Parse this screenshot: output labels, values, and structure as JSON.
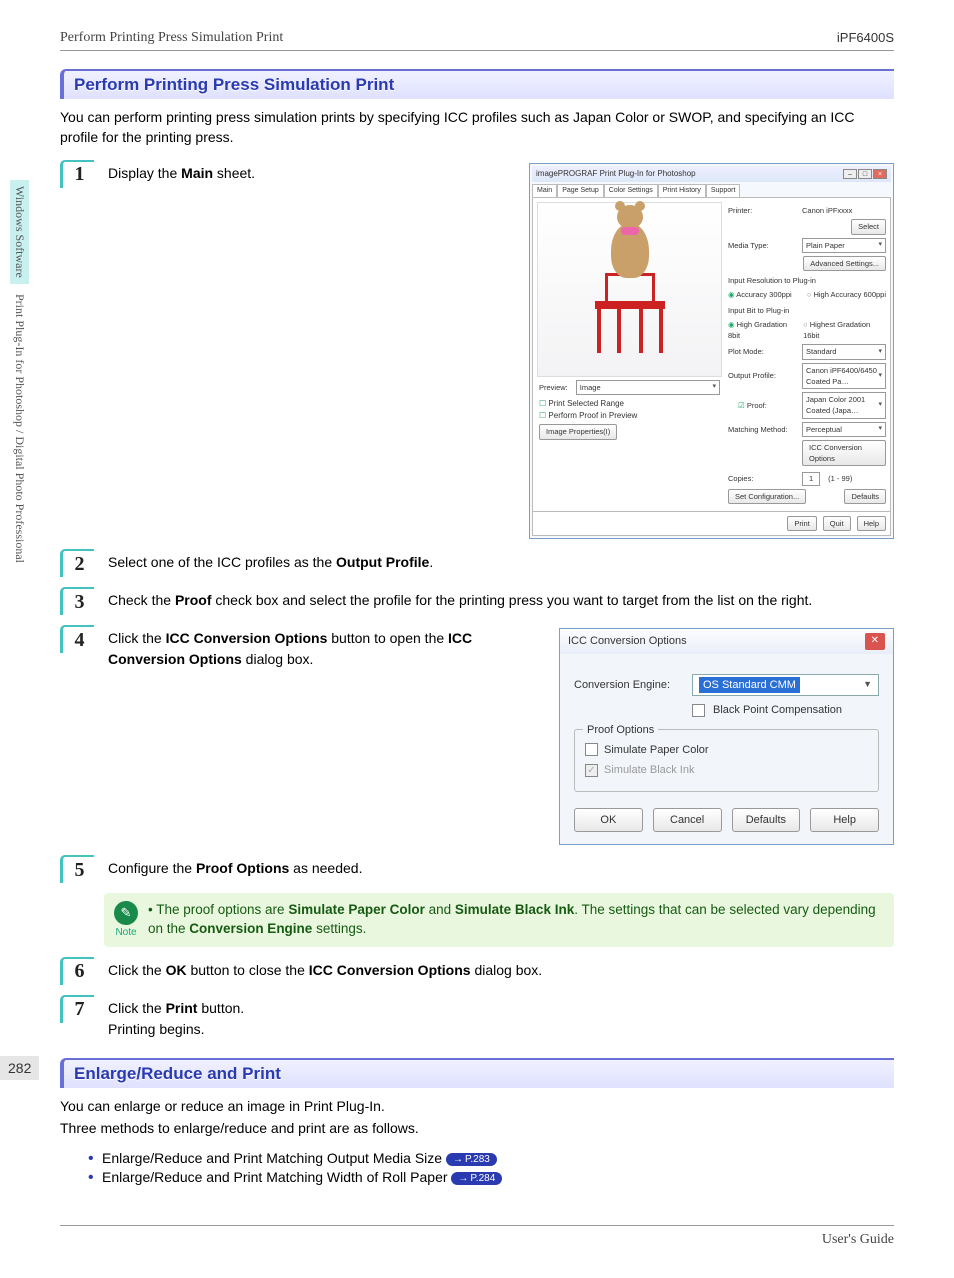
{
  "header": {
    "left": "Perform Printing Press Simulation Print",
    "right": "iPF6400S"
  },
  "side": {
    "tab1": "Windows Software",
    "tab2": "Print Plug-In for Photoshop / Digital Photo Professional"
  },
  "section1": {
    "title": "Perform Printing Press Simulation Print",
    "intro": "You can perform printing press simulation prints by specifying ICC profiles such as Japan Color or SWOP, and specifying an ICC profile for the printing press."
  },
  "steps": {
    "s1": {
      "num": "1",
      "pre": "Display the ",
      "b1": "Main",
      "post": " sheet."
    },
    "s2": {
      "num": "2",
      "pre": "Select one of the ICC profiles as the ",
      "b1": "Output Profile",
      "post": "."
    },
    "s3": {
      "num": "3",
      "pre": "Check the ",
      "b1": "Proof",
      "post": " check box and select the profile for the printing press you want to target from the list on the right."
    },
    "s4": {
      "num": "4",
      "pre": "Click the ",
      "b1": "ICC Conversion Options",
      "mid": " button to open the ",
      "b2": "ICC Conversion Options",
      "post": " dialog box."
    },
    "s5": {
      "num": "5",
      "pre": "Configure the ",
      "b1": "Proof Options",
      "post": " as needed."
    },
    "s6": {
      "num": "6",
      "pre": "Click the ",
      "b1": "OK",
      "mid": " button to close the ",
      "b2": "ICC Conversion Options",
      "post": " dialog box."
    },
    "s7": {
      "num": "7",
      "pre": "Click the ",
      "b1": "Print",
      "post": " button.",
      "line2": "Printing begins."
    }
  },
  "dialog1": {
    "title": "imagePROGRAF Print Plug-In for Photoshop",
    "tabs": [
      "Main",
      "Page Setup",
      "Color Settings",
      "Print History",
      "Support"
    ],
    "printer_l": "Printer:",
    "printer_v": "Canon iPFxxxx",
    "select_btn": "Select",
    "media_l": "Media Type:",
    "media_v": "Plain Paper",
    "adv_btn": "Advanced Settings...",
    "res_group": "Input Resolution to Plug-in",
    "res1": "Accuracy 300ppi",
    "res2": "High Accuracy 600ppi",
    "bit_group": "Input Bit to Plug-in",
    "bit1": "High Gradation 8bit",
    "bit2": "Highest Gradation 16bit",
    "plot_l": "Plot Mode:",
    "plot_v": "Standard",
    "out_l": "Output Profile:",
    "out_v": "Canon iPF6400/6450 Coated Pa…",
    "proof_l": "Proof:",
    "proof_v": "Japan Color 2001 Coated (Japa…",
    "match_l": "Matching Method:",
    "match_v": "Perceptual",
    "icc_btn": "ICC Conversion Options",
    "copies_l": "Copies:",
    "copies_v": "1",
    "copies_range": "(1 - 99)",
    "setconf": "Set Configuration...",
    "defaults": "Defaults",
    "print": "Print",
    "quit": "Quit",
    "help": "Help",
    "preview_l": "Preview:",
    "preview_v": "Image",
    "psr": "Print Selected Range",
    "ppp": "Perform Proof in Preview",
    "imgprop": "Image Properties(I)"
  },
  "dialog2": {
    "title": "ICC Conversion Options",
    "ce_l": "Conversion Engine:",
    "ce_v": "OS Standard CMM",
    "bpc": "Black Point Compensation",
    "group": "Proof Options",
    "spc": "Simulate Paper Color",
    "sbi": "Simulate Black Ink",
    "ok": "OK",
    "cancel": "Cancel",
    "defaults": "Defaults",
    "help": "Help"
  },
  "note": {
    "label": "Note",
    "pre": "The proof options are ",
    "b1": "Simulate Paper Color",
    "mid": " and ",
    "b2": "Simulate Black Ink",
    "post": ". The settings that can be selected vary depending on the ",
    "b3": "Conversion Engine",
    "end": " settings."
  },
  "section2": {
    "title": "Enlarge/Reduce and Print",
    "p1": "You can enlarge or reduce an image in Print Plug-In.",
    "p2": "Three methods to enlarge/reduce and print are as follows.",
    "b1": "Enlarge/Reduce and Print Matching Output Media Size",
    "r1": "P.283",
    "b2": "Enlarge/Reduce and Print Matching Width of Roll Paper",
    "r2": "P.284"
  },
  "pagenum": "282",
  "footer": "User's Guide"
}
